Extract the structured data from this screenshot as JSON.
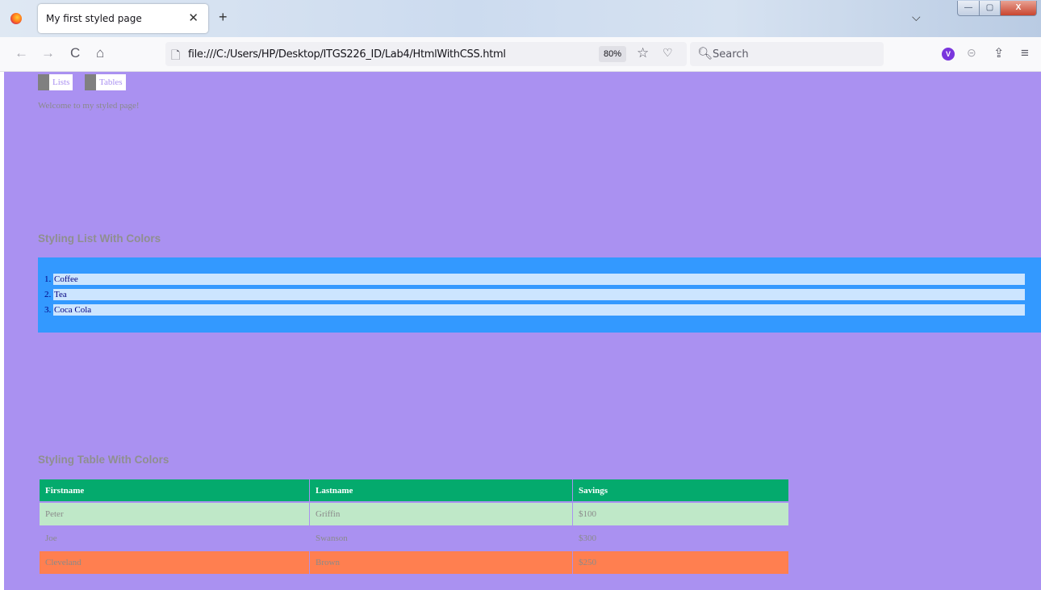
{
  "browser": {
    "tab_title": "My first styled page",
    "tab_close": "✕",
    "new_tab": "+",
    "tab_list": "⌵",
    "window_controls": {
      "minimize": "—",
      "maximize": "▢",
      "close": "X"
    },
    "url": "file:///C:/Users/HP/Desktop/ITGS226_ID/Lab4/HtmlWithCSS.html",
    "zoom": "80%",
    "search_placeholder": "Search",
    "icons": {
      "back": "←",
      "forward": "→",
      "reload": "C",
      "home": "⌂",
      "page": "🗋",
      "bookmark_star": "☆",
      "pocket": "♡",
      "search": "🔍︎",
      "extension": "V",
      "sync": "⊝",
      "share": "⇪",
      "menu": "≡"
    }
  },
  "page": {
    "background": "#aa91f1",
    "nav": {
      "lists": "Lists",
      "tables": "Tables"
    },
    "welcome": "Welcome to my styled page!",
    "list_heading": "Styling List With Colors",
    "list": {
      "box_color": "#3399ff",
      "item_color": "#cce5ff",
      "items": [
        {
          "num": "1.",
          "label": "Coffee"
        },
        {
          "num": "2.",
          "label": "Tea"
        },
        {
          "num": "3.",
          "label": "Coca Cola"
        }
      ]
    },
    "table_heading": "Styling Table With Colors",
    "table": {
      "header_color": "#04aa6d",
      "headers": [
        "Firstname",
        "Lastname",
        "Savings"
      ],
      "rows": [
        [
          "Peter",
          "Griffin",
          "$100"
        ],
        [
          "Joe",
          "Swanson",
          "$300"
        ],
        [
          "Cleveland",
          "Brown",
          "$250"
        ]
      ]
    }
  }
}
